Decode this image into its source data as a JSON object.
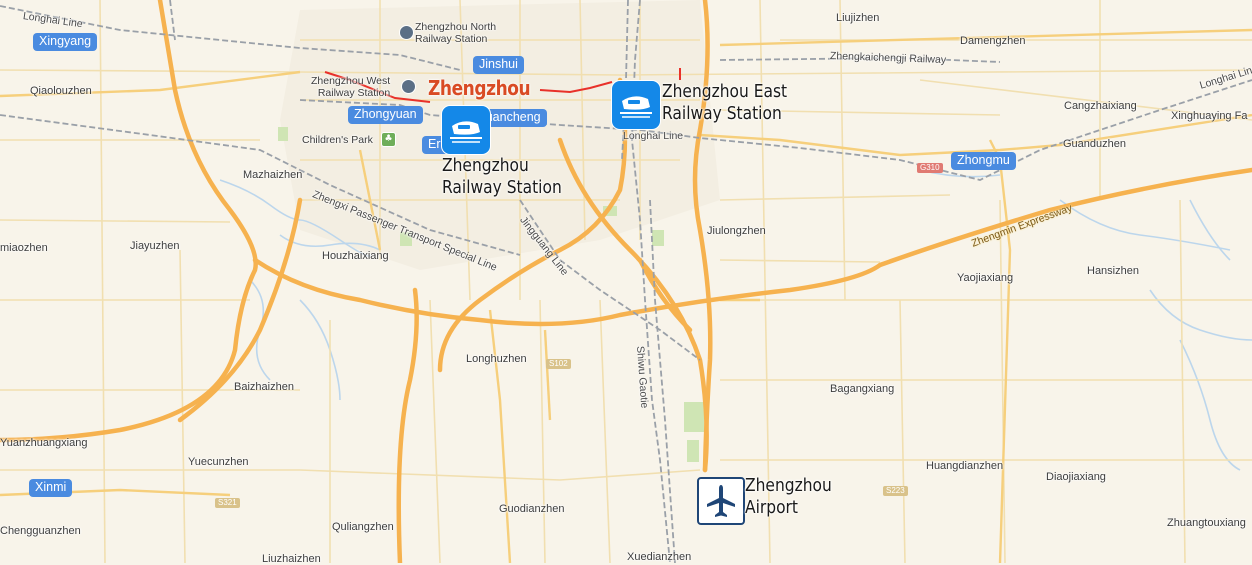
{
  "colors": {
    "background": "#f8f4ea",
    "expressway": "#f6b24f",
    "road": "#f3dfa8",
    "rail": "#9aa0a8",
    "metro_red": "#e8312a",
    "water": "#bcd6ec",
    "park": "#cfe5b4",
    "district_badge": "#4a8be0",
    "city_label": "#d94b24",
    "station_icon": "#1488e8",
    "airport_icon_border": "#1f4677"
  },
  "city": {
    "name": "Zhengzhou"
  },
  "districts": [
    "Xingyang",
    "Jinshui",
    "Zhongyuan",
    "Guancheng",
    "Erqi",
    "Zhongmu",
    "Xinmi"
  ],
  "pois": {
    "railway_station": {
      "name": "Zhengzhou\nRailway Station",
      "icon": "high-speed-train-icon"
    },
    "east_station": {
      "name": "Zhengzhou East\nRailway Station",
      "icon": "high-speed-train-icon"
    },
    "airport": {
      "name": "Zhengzhou\nAirport",
      "icon": "airplane-icon"
    },
    "north_station": {
      "name": "Zhengzhou North\nRailway Station",
      "icon": "railway-station-icon"
    },
    "west_station": {
      "name": "Zhengzhou West\nRailway Station",
      "icon": "railway-station-icon"
    },
    "childrens_park": {
      "name": "Children's Park",
      "icon": "park-tree-icon"
    }
  },
  "places": [
    "Qiaolouzhen",
    "Liujizhen",
    "Damengzhen",
    "Cangzhaixiang",
    "Xinghuaying Fa",
    "Guanduzhen",
    "Mazhaizhen",
    "Jiayuzhen",
    "miaozhen",
    "Houzhaixiang",
    "Jiulongzhen",
    "Yaojiaxiang",
    "Hansizhen",
    "Longhuzhen",
    "Baizhaizhen",
    "Bagangxiang",
    "Yuanzhuangxiang",
    "Yuecunzhen",
    "Huangdianzhen",
    "Diaojiaxiang",
    "Guodianzhen",
    "Quliangzhen",
    "Chengguanzhen",
    "Zhuangtouxiang",
    "Xuedianzhen",
    "Liuzhaizhen"
  ],
  "lines": {
    "longhai_west": "Longhai Line",
    "longhai_east": "Longhai Line",
    "longhai_center": "Longhai Line",
    "zhengkai": "Zhengkaichengji Railway",
    "zhengxi": "Zhengxi Passenger Transport Special Line",
    "jingguang": "Jingguang Line",
    "shiwu": "Shiwu Gaotie",
    "zhengmin": "Zhengmin Expressway"
  },
  "road_shields": {
    "g310": "G310",
    "s102": "S102",
    "s321": "S321",
    "s223": "S223"
  }
}
